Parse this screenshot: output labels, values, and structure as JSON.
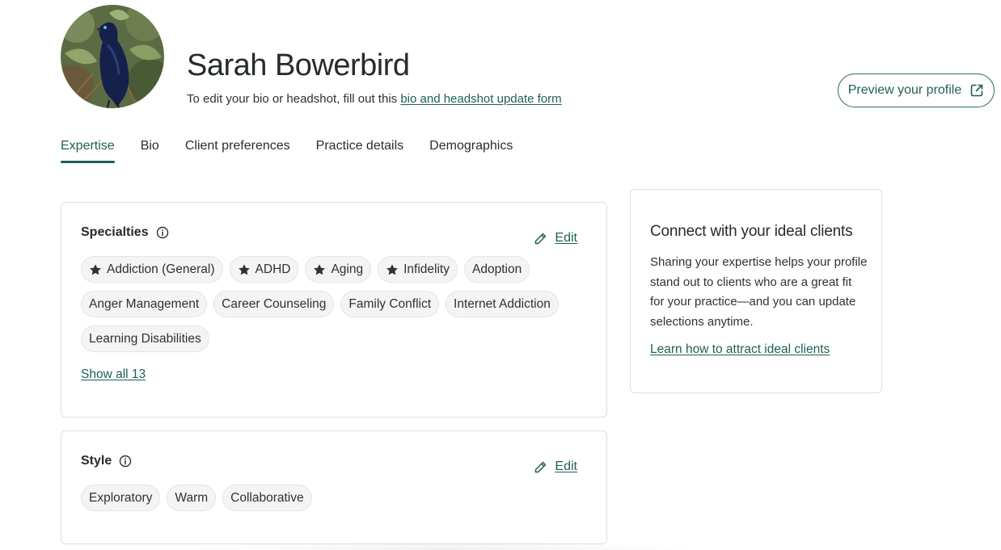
{
  "profile": {
    "name": "Sarah Bowerbird",
    "edit_note": "To edit your bio or headshot, fill out this ",
    "edit_link": "bio and headshot update form",
    "preview_label": "Preview your profile"
  },
  "tabs": [
    {
      "label": "Expertise",
      "active": true
    },
    {
      "label": "Bio"
    },
    {
      "label": "Client preferences"
    },
    {
      "label": "Practice details"
    },
    {
      "label": "Demographics"
    }
  ],
  "specialties": {
    "title": "Specialties",
    "edit_label": "Edit",
    "chips": [
      {
        "label": "Addiction (General)",
        "starred": true
      },
      {
        "label": "ADHD",
        "starred": true
      },
      {
        "label": "Aging",
        "starred": true
      },
      {
        "label": "Infidelity",
        "starred": true
      },
      {
        "label": "Adoption"
      },
      {
        "label": "Anger Management"
      },
      {
        "label": "Career Counseling"
      },
      {
        "label": "Family Conflict"
      },
      {
        "label": "Internet Addiction"
      },
      {
        "label": "Learning Disabilities"
      }
    ],
    "show_all": "Show all 13"
  },
  "style": {
    "title": "Style",
    "edit_label": "Edit",
    "chips": [
      {
        "label": "Exploratory"
      },
      {
        "label": "Warm"
      },
      {
        "label": "Collaborative"
      }
    ]
  },
  "sidebar_card": {
    "title": "Connect with your ideal clients",
    "text": "Sharing your expertise helps your profile stand out to clients who are a great fit for your practice—and you can update selections anytime.",
    "link": "Learn how to attract ideal clients"
  },
  "icons": {
    "info": "info-circle-icon",
    "edit": "pencil-icon",
    "external": "external-link-icon",
    "star": "star-icon"
  },
  "colors": {
    "accent": "#1e5f55",
    "chip_bg": "#f4f4f4",
    "border": "#dedede"
  }
}
